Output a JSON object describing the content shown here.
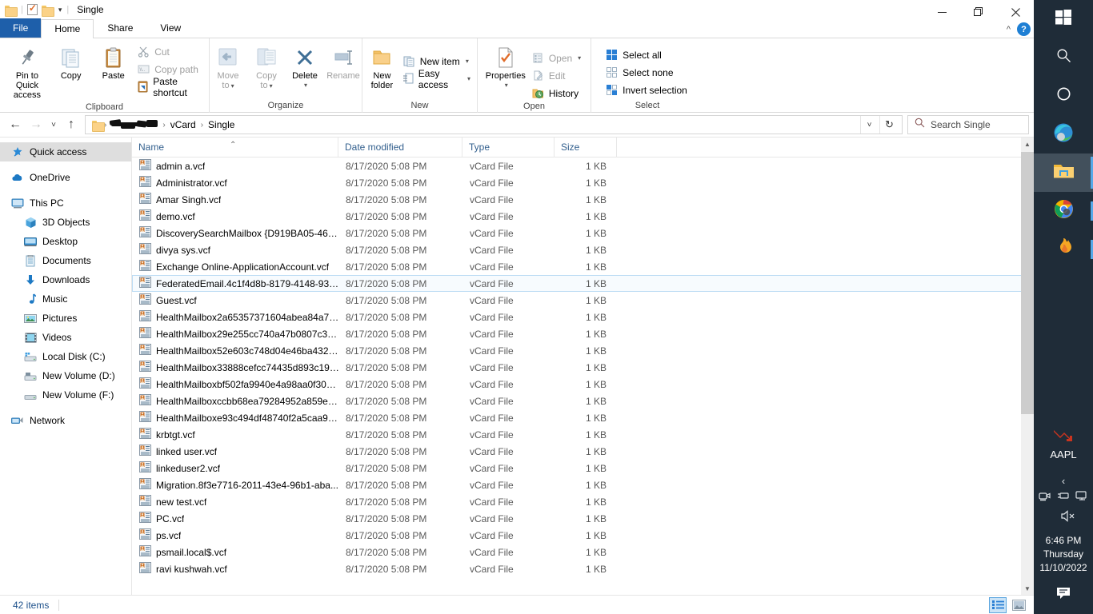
{
  "window": {
    "title": "Single",
    "quick_access_toolbar": [
      "folder-icon",
      "properties-icon",
      "new-folder-icon",
      "customize-caret"
    ],
    "controls": {
      "minimize": "—",
      "maximize": "❐",
      "close": "✕"
    },
    "ribbon_collapse": "^",
    "help": "?"
  },
  "tabs": [
    {
      "label": "File",
      "id": "file",
      "style": "file"
    },
    {
      "label": "Home",
      "id": "home",
      "active": true
    },
    {
      "label": "Share",
      "id": "share",
      "active": false
    },
    {
      "label": "View",
      "id": "view",
      "active": false
    }
  ],
  "ribbon": {
    "groups": [
      {
        "label": "Clipboard",
        "big": [
          {
            "label": "Pin to Quick\naccess",
            "label_line1": "Pin to Quick",
            "label_line2": "access",
            "icon": "pin-icon",
            "disabled": false
          },
          {
            "label": "Copy",
            "icon": "copy-icon",
            "disabled": false
          },
          {
            "label": "Paste",
            "icon": "paste-icon",
            "disabled": false
          }
        ],
        "small": [
          {
            "label": "Cut",
            "icon": "scissors-icon",
            "disabled": true
          },
          {
            "label": "Copy path",
            "icon": "copy-path-icon",
            "disabled": true
          },
          {
            "label": "Paste shortcut",
            "icon": "paste-shortcut-icon",
            "disabled": false
          }
        ]
      },
      {
        "label": "Organize",
        "big": [
          {
            "label_line1": "Move",
            "label_line2": "to",
            "icon": "move-to-icon",
            "disabled": true,
            "dropdown": true
          },
          {
            "label_line1": "Copy",
            "label_line2": "to",
            "icon": "copy-to-icon",
            "disabled": true,
            "dropdown": true
          },
          {
            "label": "Delete",
            "icon": "delete-icon",
            "disabled": false,
            "dropdown": true
          },
          {
            "label": "Rename",
            "icon": "rename-icon",
            "disabled": true
          }
        ],
        "small": []
      },
      {
        "label": "New",
        "big": [
          {
            "label_line1": "New",
            "label_line2": "folder",
            "icon": "new-folder-icon",
            "disabled": false
          }
        ],
        "small": [
          {
            "label": "New item",
            "icon": "new-item-icon",
            "disabled": false,
            "dropdown": true
          },
          {
            "label": "Easy access",
            "icon": "easy-access-icon",
            "disabled": false,
            "dropdown": true
          }
        ]
      },
      {
        "label": "Open",
        "big": [
          {
            "label": "Properties",
            "icon": "properties-icon",
            "disabled": false,
            "dropdown": true
          }
        ],
        "small": [
          {
            "label": "Open",
            "icon": "open-icon",
            "disabled": true,
            "dropdown": true
          },
          {
            "label": "Edit",
            "icon": "edit-icon",
            "disabled": true
          },
          {
            "label": "History",
            "icon": "history-icon",
            "disabled": false
          }
        ]
      },
      {
        "label": "Select",
        "big": [],
        "small": [
          {
            "label": "Select all",
            "icon": "select-all-icon",
            "disabled": false
          },
          {
            "label": "Select none",
            "icon": "select-none-icon",
            "disabled": false
          },
          {
            "label": "Invert selection",
            "icon": "invert-selection-icon",
            "disabled": false
          }
        ]
      }
    ]
  },
  "address": {
    "back": "←",
    "forward": "→",
    "recent": "˅",
    "up": "↑",
    "breadcrumbs": [
      {
        "label": "",
        "type": "folder-icon"
      },
      {
        "label": "",
        "type": "redacted"
      },
      {
        "label": "vCard",
        "type": "text"
      },
      {
        "label": "Single",
        "type": "text"
      }
    ],
    "dropdown": "˅",
    "refresh": "↻"
  },
  "search": {
    "placeholder": "Search Single",
    "icon": "search-icon"
  },
  "navpane": {
    "items": [
      {
        "label": "Quick access",
        "icon": "star-pin-icon",
        "indent": false,
        "selected": true
      },
      {
        "label": "OneDrive",
        "icon": "cloud-icon",
        "indent": false,
        "selected": false,
        "gap_before": true
      },
      {
        "label": "This PC",
        "icon": "monitor-icon",
        "indent": false,
        "selected": false,
        "gap_before": true
      },
      {
        "label": "3D Objects",
        "icon": "cube-icon",
        "indent": true,
        "selected": false
      },
      {
        "label": "Desktop",
        "icon": "desktop-icon",
        "indent": true,
        "selected": false
      },
      {
        "label": "Documents",
        "icon": "documents-icon",
        "indent": true,
        "selected": false
      },
      {
        "label": "Downloads",
        "icon": "download-icon",
        "indent": true,
        "selected": false
      },
      {
        "label": "Music",
        "icon": "music-icon",
        "indent": true,
        "selected": false
      },
      {
        "label": "Pictures",
        "icon": "pictures-icon",
        "indent": true,
        "selected": false
      },
      {
        "label": "Videos",
        "icon": "videos-icon",
        "indent": true,
        "selected": false
      },
      {
        "label": "Local Disk (C:)",
        "icon": "drive-icon",
        "indent": true,
        "selected": false
      },
      {
        "label": "New Volume (D:)",
        "icon": "drive-icon",
        "indent": true,
        "selected": false
      },
      {
        "label": "New Volume (F:)",
        "icon": "drive-icon",
        "indent": true,
        "selected": false
      },
      {
        "label": "Network",
        "icon": "network-icon",
        "indent": false,
        "selected": false,
        "gap_before": true
      }
    ]
  },
  "filelist": {
    "columns": [
      {
        "key": "name",
        "label": "Name",
        "sorted": "asc"
      },
      {
        "key": "date",
        "label": "Date modified"
      },
      {
        "key": "type",
        "label": "Type"
      },
      {
        "key": "size",
        "label": "Size"
      }
    ],
    "rows": [
      {
        "name": "admin a.vcf",
        "date": "8/17/2020 5:08 PM",
        "type": "vCard File",
        "size": "1 KB"
      },
      {
        "name": "Administrator.vcf",
        "date": "8/17/2020 5:08 PM",
        "type": "vCard File",
        "size": "1 KB"
      },
      {
        "name": "Amar Singh.vcf",
        "date": "8/17/2020 5:08 PM",
        "type": "vCard File",
        "size": "1 KB"
      },
      {
        "name": "demo.vcf",
        "date": "8/17/2020 5:08 PM",
        "type": "vCard File",
        "size": "1 KB"
      },
      {
        "name": "DiscoverySearchMailbox {D919BA05-46A...",
        "date": "8/17/2020 5:08 PM",
        "type": "vCard File",
        "size": "1 KB"
      },
      {
        "name": "divya sys.vcf",
        "date": "8/17/2020 5:08 PM",
        "type": "vCard File",
        "size": "1 KB"
      },
      {
        "name": "Exchange Online-ApplicationAccount.vcf",
        "date": "8/17/2020 5:08 PM",
        "type": "vCard File",
        "size": "1 KB"
      },
      {
        "name": "FederatedEmail.4c1f4d8b-8179-4148-93b...",
        "date": "8/17/2020 5:08 PM",
        "type": "vCard File",
        "size": "1 KB",
        "hovered": true
      },
      {
        "name": "Guest.vcf",
        "date": "8/17/2020 5:08 PM",
        "type": "vCard File",
        "size": "1 KB"
      },
      {
        "name": "HealthMailbox2a65357371604abea84a715...",
        "date": "8/17/2020 5:08 PM",
        "type": "vCard File",
        "size": "1 KB"
      },
      {
        "name": "HealthMailbox29e255cc740a47b0807c3e...",
        "date": "8/17/2020 5:08 PM",
        "type": "vCard File",
        "size": "1 KB"
      },
      {
        "name": "HealthMailbox52e603c748d04e46ba432e...",
        "date": "8/17/2020 5:08 PM",
        "type": "vCard File",
        "size": "1 KB"
      },
      {
        "name": "HealthMailbox33888cefcc74435d893c19d...",
        "date": "8/17/2020 5:08 PM",
        "type": "vCard File",
        "size": "1 KB"
      },
      {
        "name": "HealthMailboxbf502fa9940e4a98aa0f3088...",
        "date": "8/17/2020 5:08 PM",
        "type": "vCard File",
        "size": "1 KB"
      },
      {
        "name": "HealthMailboxccbb68ea79284952a859ee...",
        "date": "8/17/2020 5:08 PM",
        "type": "vCard File",
        "size": "1 KB"
      },
      {
        "name": "HealthMailboxe93c494df48740f2a5caa94...",
        "date": "8/17/2020 5:08 PM",
        "type": "vCard File",
        "size": "1 KB"
      },
      {
        "name": "krbtgt.vcf",
        "date": "8/17/2020 5:08 PM",
        "type": "vCard File",
        "size": "1 KB"
      },
      {
        "name": "linked user.vcf",
        "date": "8/17/2020 5:08 PM",
        "type": "vCard File",
        "size": "1 KB"
      },
      {
        "name": "linkeduser2.vcf",
        "date": "8/17/2020 5:08 PM",
        "type": "vCard File",
        "size": "1 KB"
      },
      {
        "name": "Migration.8f3e7716-2011-43e4-96b1-aba...",
        "date": "8/17/2020 5:08 PM",
        "type": "vCard File",
        "size": "1 KB"
      },
      {
        "name": "new test.vcf",
        "date": "8/17/2020 5:08 PM",
        "type": "vCard File",
        "size": "1 KB"
      },
      {
        "name": "PC.vcf",
        "date": "8/17/2020 5:08 PM",
        "type": "vCard File",
        "size": "1 KB"
      },
      {
        "name": "ps.vcf",
        "date": "8/17/2020 5:08 PM",
        "type": "vCard File",
        "size": "1 KB"
      },
      {
        "name": "psmail.local$.vcf",
        "date": "8/17/2020 5:08 PM",
        "type": "vCard File",
        "size": "1 KB"
      },
      {
        "name": "ravi kushwah.vcf",
        "date": "8/17/2020 5:08 PM",
        "type": "vCard File",
        "size": "1 KB"
      }
    ]
  },
  "statusbar": {
    "items_text": "42 items",
    "views": [
      {
        "name": "details-view",
        "active": true
      },
      {
        "name": "large-icons-view",
        "active": false
      }
    ]
  },
  "taskbar": {
    "buttons": [
      {
        "name": "start-button",
        "icon": "windows-logo-icon"
      },
      {
        "name": "search-button",
        "icon": "search-icon"
      },
      {
        "name": "cortana-button",
        "icon": "cortana-circle-icon"
      },
      {
        "name": "edge-button",
        "icon": "edge-icon"
      },
      {
        "name": "file-explorer-button",
        "icon": "folder-icon",
        "active": true
      },
      {
        "name": "chrome-button",
        "icon": "chrome-icon",
        "open": true
      },
      {
        "name": "firefox-button",
        "icon": "flame-icon",
        "open": true
      }
    ],
    "stock": {
      "symbol": "AAPL",
      "icon": "stock-down-icon"
    },
    "tray": {
      "chevron": "‹",
      "icons": [
        "camera-icon",
        "usb-device-icon",
        "display-icon"
      ],
      "volume": "volume-muted-icon"
    },
    "clock": {
      "time": "6:46 PM",
      "day": "Thursday",
      "date": "11/10/2022"
    },
    "action_center": "action-center-icon"
  },
  "colors": {
    "accent": "#1e5faa",
    "taskbar_bg": "#1f2c38",
    "selection": "#cce4f7",
    "header_text": "#33608e"
  }
}
